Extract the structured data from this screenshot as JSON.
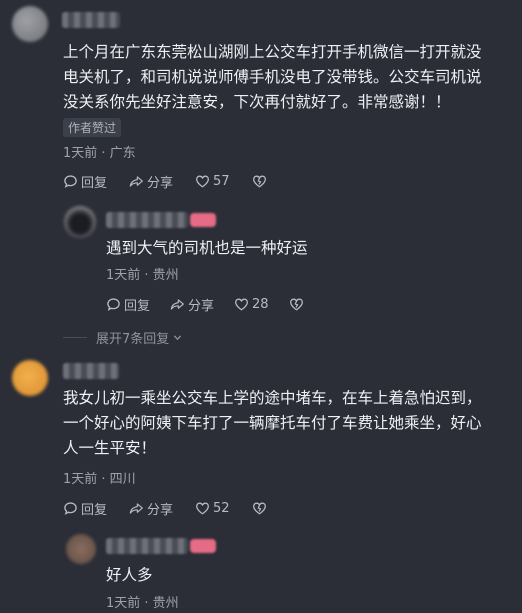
{
  "comments": [
    {
      "text": "上个月在广东东莞松山湖刚上公交车打开手机微信一打开就没电关机了，和司机说说师傅手机没电了没带钱。公交车司机说没关系你先坐好注意安，下次再付就好了。非常感谢！！",
      "line1": "上个月在广东东莞松山湖刚上公交车打开手机微信一打开就没",
      "line2": "电关机了，和司机说说师傅手机没电了没带钱。公交车司机说",
      "line3": "没关系你先坐好注意安，下次再付就好了。非常感谢！！",
      "tag": "作者赞过",
      "meta": "1天前 · 广东",
      "reply_label": "回复",
      "share_label": "分享",
      "likes": "57"
    },
    {
      "text": "遇到大气的司机也是一种好运",
      "meta": "1天前 · 贵州",
      "reply_label": "回复",
      "share_label": "分享",
      "likes": "28"
    },
    {
      "line1": "我女儿初一乘坐公交车上学的途中堵车，在车上着急怕迟到，",
      "line2": "一个好心的阿姨下车打了一辆摩托车付了车费让她乘坐，好心",
      "line3": "人一生平安！",
      "meta": "1天前 · 四川",
      "reply_label": "回复",
      "share_label": "分享",
      "likes": "52"
    },
    {
      "text": "好人多",
      "meta": "1天前 · 贵州"
    }
  ],
  "expand_replies": "展开7条回复",
  "icons": [
    "reply-bubble-icon",
    "share-arrow-icon",
    "heart-icon",
    "dislike-heart-icon",
    "chevron-down-icon"
  ]
}
